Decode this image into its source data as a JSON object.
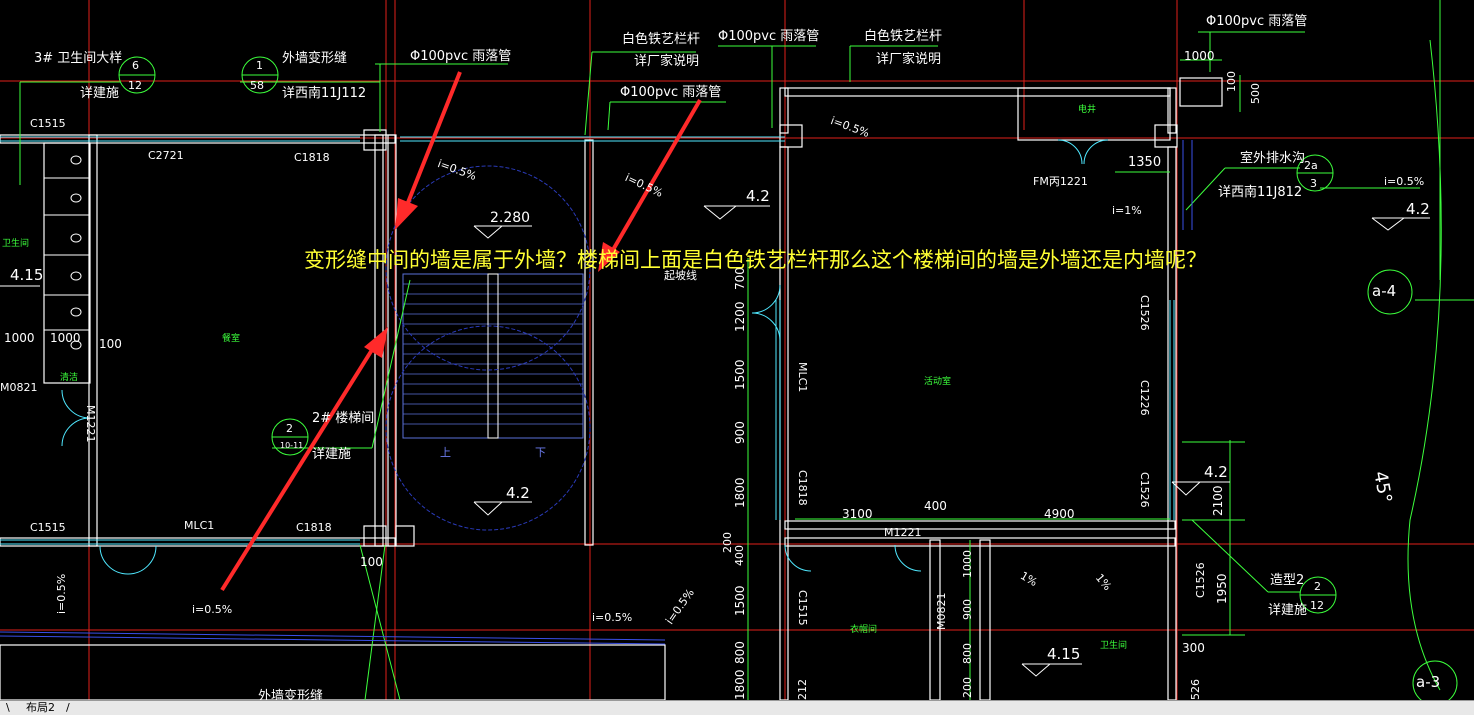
{
  "question": "变形缝中间的墙是属于外墙？楼梯间上面是白色铁艺栏杆那么这个楼梯间的墙是外墙还是内墙呢？",
  "tabs": {
    "left_glyph": "\\",
    "layout_tab": "布局2",
    "right_glyph": "/"
  },
  "callouts": {
    "wc3": "3# 卫生间大样",
    "wc3_ref": "详建施",
    "wc3_num": "6",
    "wc3_sheet": "12",
    "joint": "外墙变形缝",
    "joint_ref": "详西南11J112",
    "joint_num": "1",
    "joint_sheet": "58",
    "pipe1": "Φ100pvc 雨落管",
    "pipe2": "Φ100pvc 雨落管",
    "pipe3": "Φ100pvc 雨落管",
    "pipe4": "Φ100pvc 雨落管",
    "rail1": "白色铁艺栏杆",
    "rail1b": "详厂家说明",
    "rail2": "白色铁艺栏杆",
    "rail2b": "详厂家说明",
    "drain": "室外排水沟",
    "drain_ref": "详西南11J812",
    "drain_num": "2a",
    "drain_sheet": "3",
    "stair2": "2# 楼梯间",
    "stair2_ref": "详建施",
    "stair2_num": "2",
    "stair2_sheet": "10-11",
    "shape2": "造型2",
    "shape2_ref": "详建施",
    "shape2_num": "2",
    "shape2_sheet": "12",
    "joint_bottom": "外墙变形缝"
  },
  "labels": {
    "c1515a": "C1515",
    "c2721": "C2721",
    "c1818a": "C1818",
    "c1515b": "C1515",
    "mlc1a": "MLC1",
    "c1818b": "C1818",
    "m1221a": "M1221",
    "m0821": "M0821",
    "mlc1b": "MLC1",
    "c1818c": "C1818",
    "c1515c": "C1515",
    "c1526a": "C1526",
    "c1226": "C1226",
    "c1526b": "C1526",
    "c1526c": "C1526",
    "m1221b": "M1221",
    "m0821b": "M0821",
    "fm": "FM丙1221",
    "elev": "电井",
    "room1": "餐室",
    "room2": "活动室",
    "room3": "衣帽间",
    "room4": "卫生间",
    "room5": "卫生间",
    "room6": "清洁",
    "slope_line": "起坡线",
    "up": "上",
    "down": "下"
  },
  "elevations": {
    "e1": "2.280",
    "e2": "4.2",
    "e3": "4.2",
    "e4": "4.2",
    "e5": "4.2",
    "e6": "4.15",
    "e7": "4.15"
  },
  "slopes": {
    "s1": "i=0.5%",
    "s2": "i=0.5%",
    "s3": "i=0.5%",
    "s4": "i=0.5%",
    "s5": "i=0.5%",
    "s6": "i=0.5%",
    "s7": "i=1%",
    "s8": "i=0.5%",
    "s9": "i=0.5%",
    "s10": "1%",
    "s11": "1%"
  },
  "dims": {
    "d1000a": "1000",
    "d1000b": "1000",
    "d100a": "100",
    "d100b": "100",
    "d1000top": "1000",
    "d100top": "100",
    "d500": "500",
    "d1350": "1350",
    "d700": "700",
    "d1200": "1200",
    "d1500a": "1500",
    "d900a": "900",
    "d1800a": "1800",
    "d200a": "200",
    "d400a": "400",
    "d1500b": "1500",
    "d1800b": "1800",
    "d800": "800",
    "d212": "212",
    "d3100": "3100",
    "d400b": "400",
    "d4900": "4900",
    "d2100": "2100",
    "d1950": "1950",
    "d300": "300",
    "d1000c": "1000",
    "d900b": "900",
    "d800b": "800",
    "d200b": "200",
    "d526": "526",
    "d45": "45°"
  },
  "axes": {
    "a4": "a-4",
    "a3": "a-3"
  }
}
